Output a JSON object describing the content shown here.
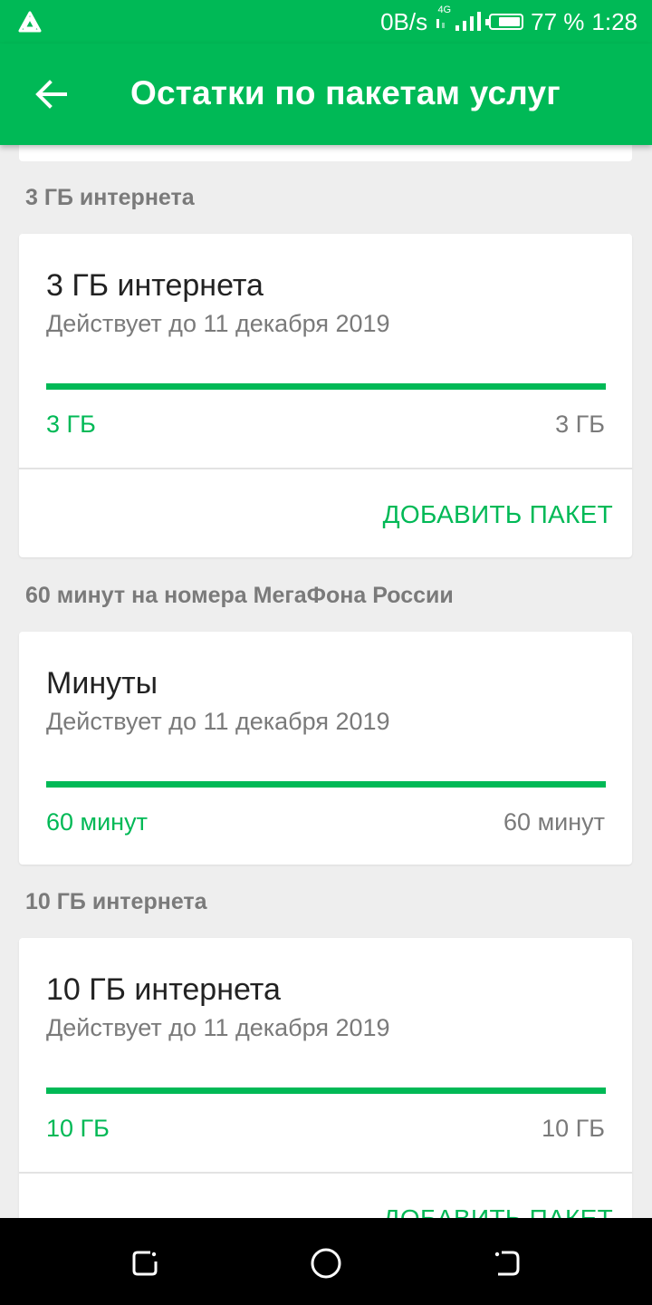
{
  "status_bar": {
    "net_speed": "0B/s",
    "net_type": "4G",
    "battery_percent": "77 %",
    "battery_level": 0.77,
    "time": "1:28"
  },
  "app_bar": {
    "title": "Остатки по пакетам услуг",
    "back_icon": "arrow-left-icon"
  },
  "packages": [
    {
      "section_label": "3 ГБ интернета",
      "title": "3 ГБ интернета",
      "valid_until": "Действует до 11 декабря 2019",
      "remaining": "3 ГБ",
      "total": "3 ГБ",
      "remaining_fraction": 1.0,
      "action_label": "ДОБАВИТЬ ПАКЕТ"
    },
    {
      "section_label": "60 минут на номера МегаФона России",
      "title": "Минуты",
      "valid_until": "Действует до 11 декабря 2019",
      "remaining": "60 минут",
      "total": "60 минут",
      "remaining_fraction": 1.0
    },
    {
      "section_label": "10 ГБ интернета",
      "title": "10 ГБ интернета",
      "valid_until": "Действует до 11 декабря 2019",
      "remaining": "10 ГБ",
      "total": "10 ГБ",
      "remaining_fraction": 1.0,
      "action_label": "ДОБАВИТЬ ПАКЕТ"
    }
  ],
  "colors": {
    "brand_green": "#00b956",
    "background": "#eeeeee"
  }
}
